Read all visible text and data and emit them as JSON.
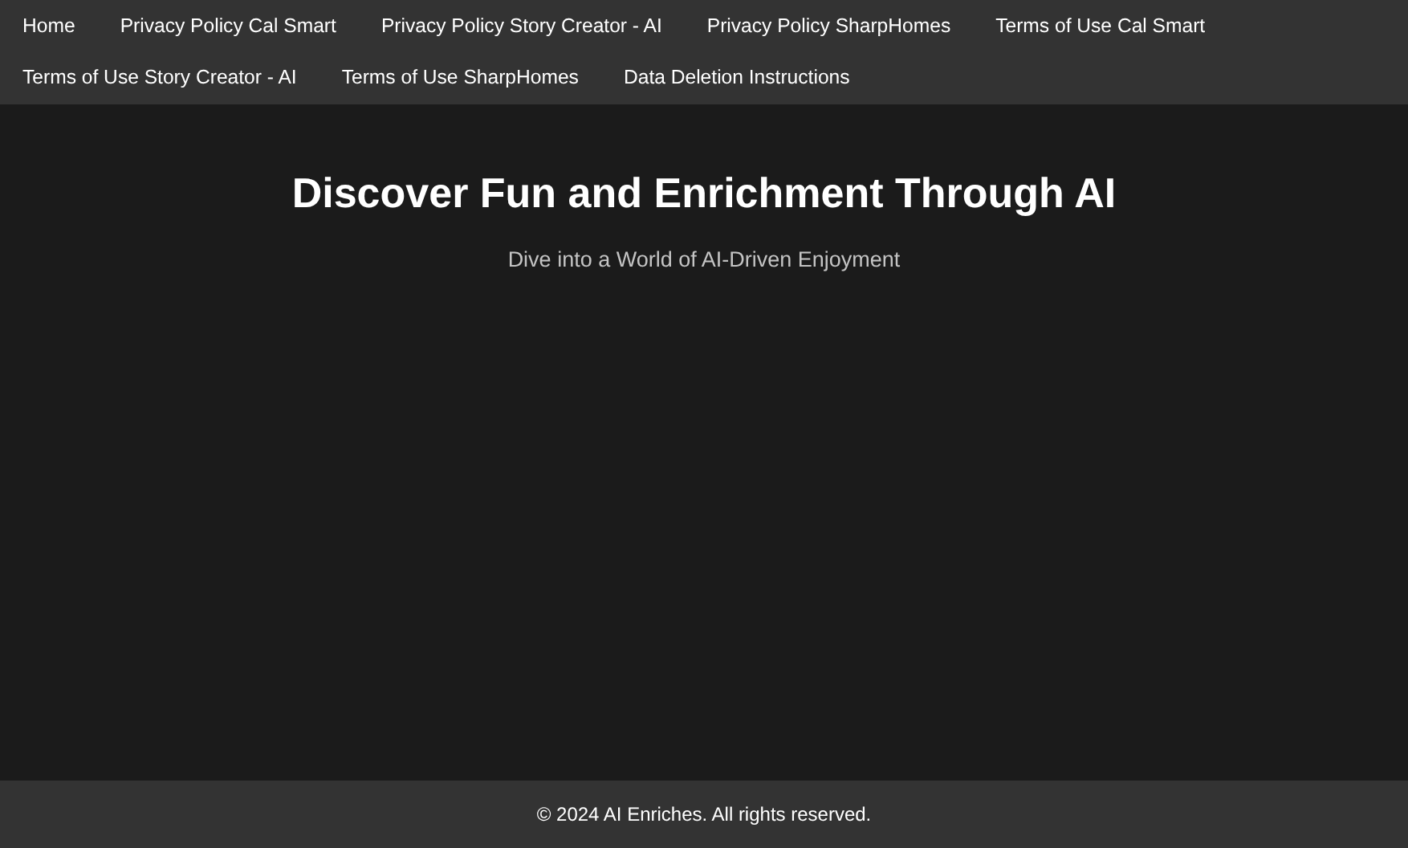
{
  "nav": {
    "items": [
      {
        "label": "Home"
      },
      {
        "label": "Privacy Policy Cal Smart"
      },
      {
        "label": "Privacy Policy Story Creator - AI"
      },
      {
        "label": "Privacy Policy SharpHomes"
      },
      {
        "label": "Terms of Use Cal Smart"
      },
      {
        "label": "Terms of Use Story Creator - AI"
      },
      {
        "label": "Terms of Use SharpHomes"
      },
      {
        "label": "Data Deletion Instructions"
      }
    ]
  },
  "hero": {
    "title": "Discover Fun and Enrichment Through AI",
    "subtitle": "Dive into a World of AI-Driven Enjoyment"
  },
  "footer": {
    "text": "© 2024 AI Enriches. All rights reserved."
  }
}
